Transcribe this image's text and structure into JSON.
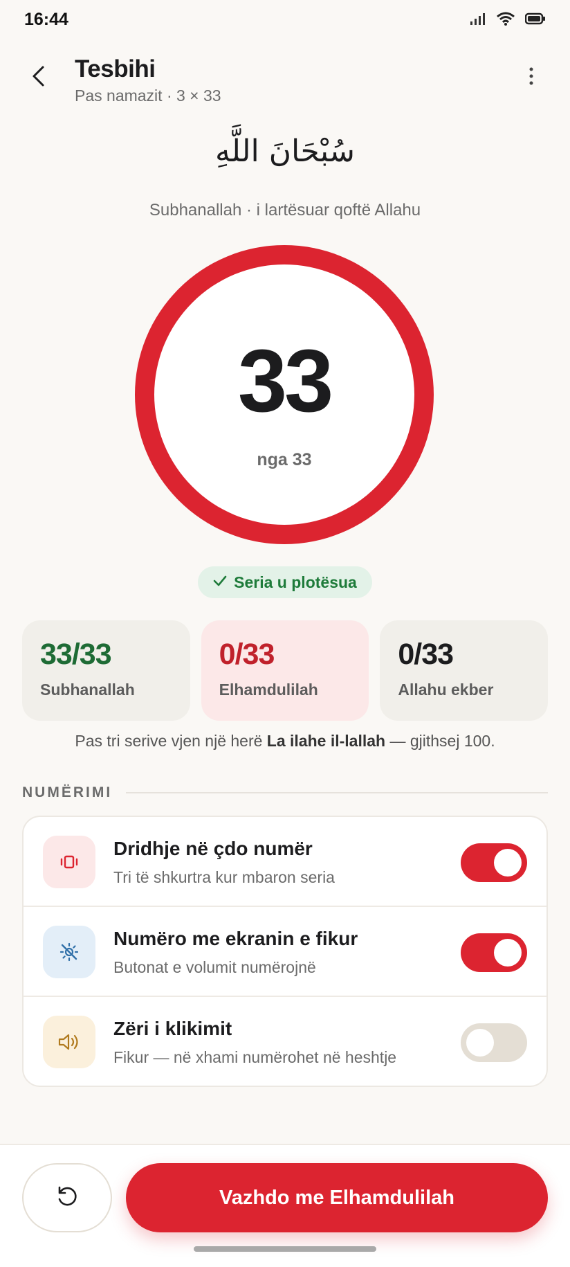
{
  "status_bar": {
    "time": "16:44"
  },
  "header": {
    "title": "Tesbihi",
    "subtitle": "Pas namazit · 3 × 33"
  },
  "dhikr": {
    "arabic": "سُبْحَانَ اللَّهِ",
    "transliteration": "Subhanallah · i lartësuar qoftë Allahu"
  },
  "counter": {
    "value": "33",
    "of_label": "nga 33",
    "progress": 1.0,
    "ring_color": "#DC2430"
  },
  "status_pill": {
    "label": "Seria u plotësua",
    "color": "#1E7B3A"
  },
  "series_cards": [
    {
      "value": "33/33",
      "label": "Subhanallah",
      "value_color": "#1E6B35",
      "bg": "#F1EFEA"
    },
    {
      "value": "0/33",
      "label": "Elhamdulilah",
      "value_color": "#C0212B",
      "bg": "#FCE8E8"
    },
    {
      "value": "0/33",
      "label": "Allahu ekber",
      "value_color": "#1C1C1E",
      "bg": "#F1EFEA"
    }
  ],
  "note": {
    "prefix": "Pas tri serive vjen një herë ",
    "bold": "La ilahe il-lallah",
    "suffix": " — gjithsej 100."
  },
  "section": {
    "title": "NUMËRIMI"
  },
  "settings": [
    {
      "title": "Dridhje në çdo numër",
      "desc": "Tri të shkurtra kur mbaron seria",
      "icon": "vibration-icon",
      "enabled": true
    },
    {
      "title": "Numëro me ekranin e fikur",
      "desc": "Butonat e volumit numërojnë",
      "icon": "screen-off-icon",
      "enabled": true
    },
    {
      "title": "Zëri i klikimit",
      "desc": "Fikur — në xhami numërohet në heshtje",
      "icon": "speaker-icon",
      "enabled": false
    }
  ],
  "bottom": {
    "reset_icon": "reset-icon",
    "continue_label": "Vazhdo me Elhamdulilah"
  },
  "colors": {
    "accent": "#DC2430",
    "background": "#FAF8F5",
    "success": "#1E7B3A"
  }
}
